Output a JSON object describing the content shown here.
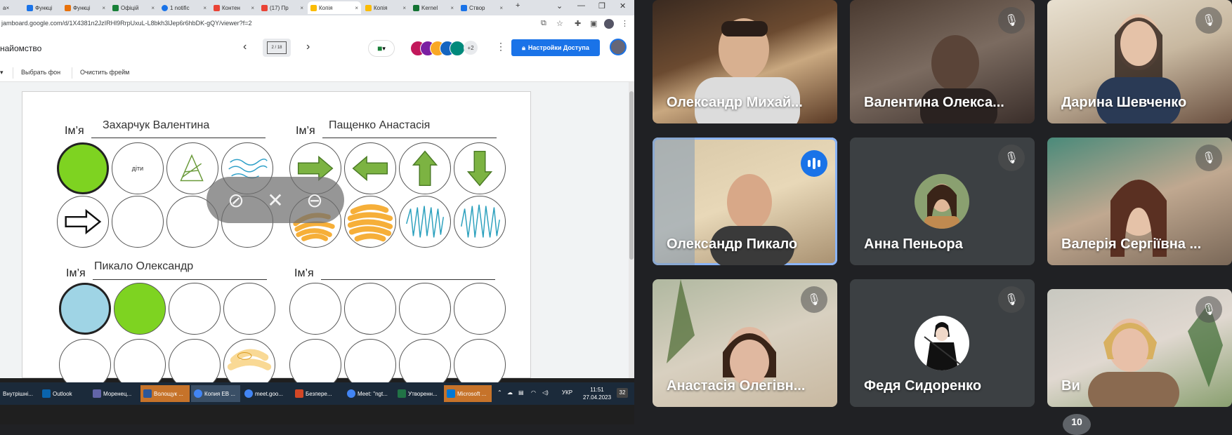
{
  "browser": {
    "tabs": [
      {
        "label": "а×",
        "color": "#888"
      },
      {
        "label": "Функці",
        "color": "#1a73e8"
      },
      {
        "label": "Функці",
        "color": "#e8710a"
      },
      {
        "label": "Офіцій",
        "color": "#188038"
      },
      {
        "label": "1 notific",
        "color": "#1a73e8"
      },
      {
        "label": "Контен",
        "color": "#ea4335"
      },
      {
        "label": "(17) Пр",
        "color": "#ea4335"
      },
      {
        "label": "Копія",
        "color": "#fbbc04"
      },
      {
        "label": "Копія",
        "color": "#fbbc04"
      },
      {
        "label": "Kernel",
        "color": "#137333"
      },
      {
        "label": "Створ",
        "color": "#1a73e8"
      }
    ],
    "new_tab": "+",
    "url": "jamboard.google.com/d/1X4381n2JzIRHl9RrpUxuL-L8bkh3lJep6r6hbDK-gQY/viewer?f=2"
  },
  "jamboard": {
    "title": "найомство",
    "frame_indicator": "2 / 18",
    "prev": "‹",
    "next": "›",
    "more_avatars": "+2",
    "share_label": "Настройки Доступа",
    "toolbar": {
      "set_background": "Выбрать фон",
      "clear_frame": "Очистить фрейм"
    },
    "board": {
      "name_label": "Ім’я",
      "students": [
        {
          "name": "Захарчук Валентина"
        },
        {
          "name": "Пащенко Анастасія"
        },
        {
          "name": "Пикало Олександр"
        },
        {
          "name": ""
        }
      ],
      "circle_text": "діти"
    }
  },
  "taskbar": {
    "apps": [
      {
        "label": "Внутрішні...",
        "color": "#666"
      },
      {
        "label": "Outlook",
        "color": "#0a64ad"
      },
      {
        "label": "Моренец...",
        "color": "#6264a7"
      },
      {
        "label": "Волощук ...",
        "color": "#2b579a"
      },
      {
        "label": "Копия ЕВ ...",
        "color": "#4285f4"
      },
      {
        "label": "meet.goo...",
        "color": "#4285f4"
      },
      {
        "label": "Безпере...",
        "color": "#d24726"
      },
      {
        "label": "Meet: \"ngt...",
        "color": "#4285f4"
      },
      {
        "label": "Утворенн...",
        "color": "#217346"
      },
      {
        "label": "Microsoft ...",
        "color": "#0078d4"
      }
    ],
    "lang": "УКР",
    "time": "11:51",
    "date": "27.04.2023",
    "notif_count": "32"
  },
  "meet": {
    "participants": [
      {
        "name": "Олександр Михай...",
        "muted": false
      },
      {
        "name": "Валентина Олекса...",
        "muted": true
      },
      {
        "name": "Дарина Шевченко",
        "muted": true
      },
      {
        "name": "Олександр Пикало",
        "muted": false,
        "speaking": true
      },
      {
        "name": "Анна Пеньора",
        "muted": true
      },
      {
        "name": "Валерія Сергіївна ...",
        "muted": true
      },
      {
        "name": "Анастасія Олегівн...",
        "muted": true
      },
      {
        "name": "Федя Сидоренко",
        "muted": true
      },
      {
        "name": "Ви",
        "muted": true
      }
    ],
    "more_count": "10"
  }
}
